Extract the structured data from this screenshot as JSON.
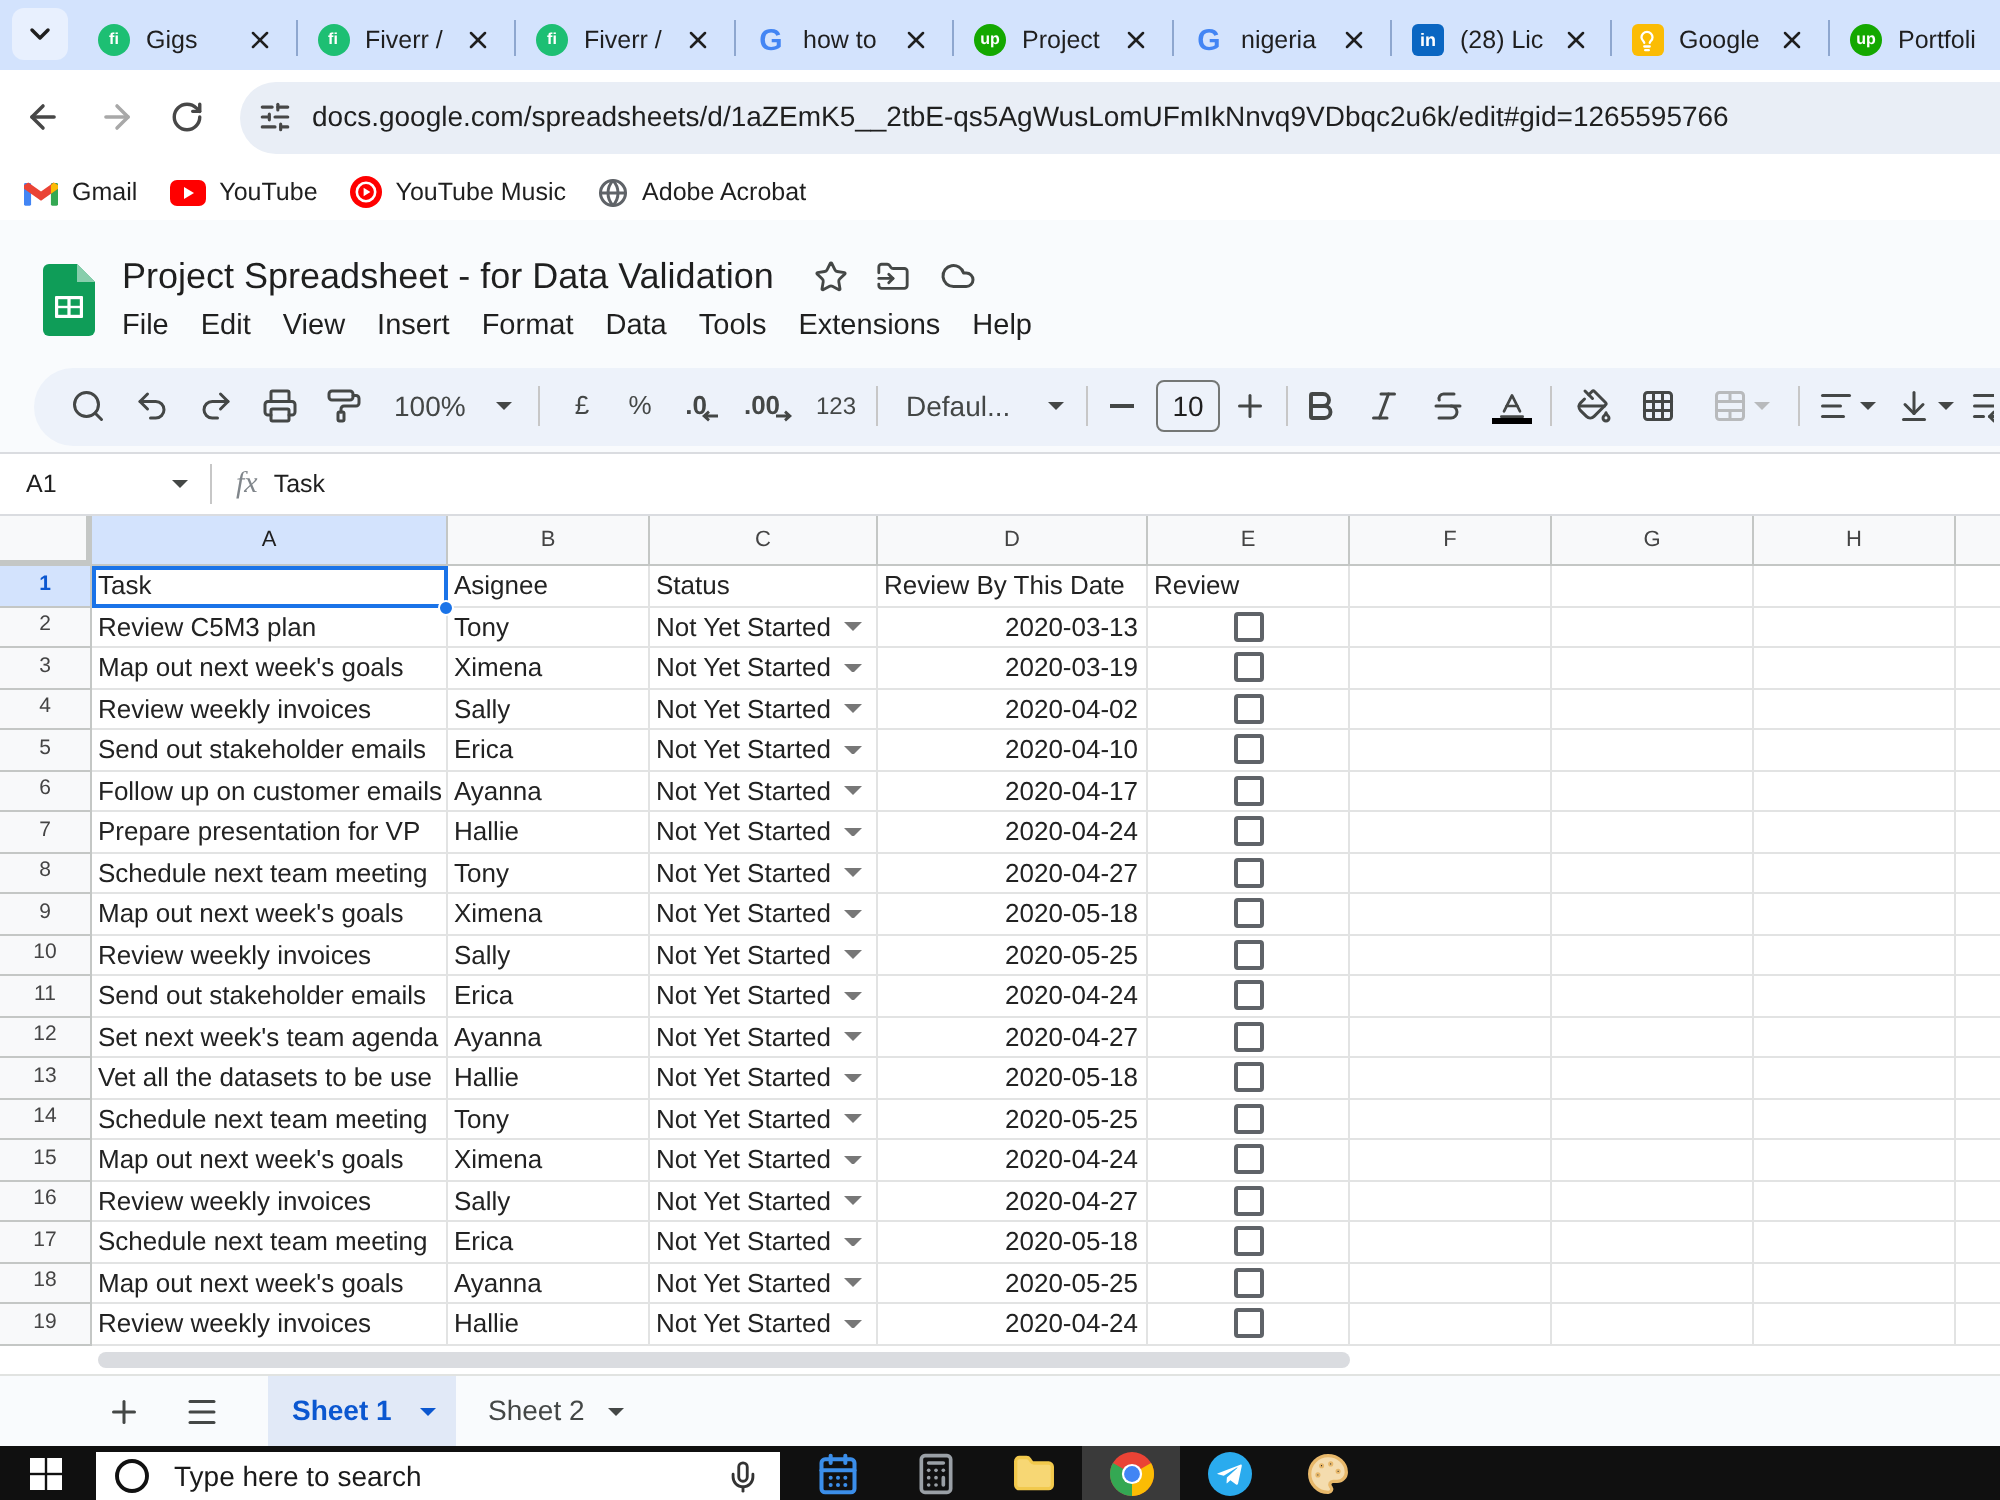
{
  "browser": {
    "tabs": [
      {
        "title": "Gigs",
        "selected": false,
        "favicon": {
          "kind": "disc",
          "color": "#1dbf73",
          "text": "fi"
        }
      },
      {
        "title": "Fiverr /",
        "selected": false,
        "favicon": {
          "kind": "disc",
          "color": "#1dbf73",
          "text": "fi"
        }
      },
      {
        "title": "Fiverr /",
        "selected": false,
        "favicon": {
          "kind": "disc",
          "color": "#1dbf73",
          "text": "fi"
        }
      },
      {
        "title": "how to",
        "selected": false,
        "favicon": {
          "kind": "letter",
          "color": "#4285f4",
          "text": "G"
        }
      },
      {
        "title": "Project",
        "selected": false,
        "favicon": {
          "kind": "disc",
          "color": "#14a800",
          "text": "up"
        }
      },
      {
        "title": "nigeria",
        "selected": false,
        "favicon": {
          "kind": "letter",
          "color": "#4285f4",
          "text": "G"
        }
      },
      {
        "title": "(28) Lic",
        "selected": false,
        "favicon": {
          "kind": "square",
          "color": "#0a66c2",
          "text": "in"
        }
      },
      {
        "title": "Google",
        "selected": false,
        "favicon": {
          "kind": "bulb",
          "color": "#fbbc04"
        }
      },
      {
        "title": "Portfoli",
        "selected": false,
        "favicon": {
          "kind": "disc",
          "color": "#14a800",
          "text": "up"
        }
      }
    ],
    "nav": {
      "forward_disabled": true
    },
    "address": {
      "url": "docs.google.com/spreadsheets/d/1aZEmK5__2tbE-qs5AgWusLomUFmIkNnvq9VDbqc2u6k/edit#gid=1265595766"
    },
    "bookmarks": [
      {
        "label": "Gmail",
        "kind": "mail"
      },
      {
        "label": "YouTube",
        "kind": "video"
      },
      {
        "label": "YouTube Music",
        "kind": "music"
      },
      {
        "label": "Adobe Acrobat",
        "kind": "globe"
      }
    ]
  },
  "sheet_doc": {
    "title": "Project Spreadsheet - for Data Validation",
    "menu": [
      "File",
      "Edit",
      "View",
      "Insert",
      "Format",
      "Data",
      "Tools",
      "Extensions",
      "Help"
    ],
    "toolbar": {
      "zoom": "100%",
      "currency": "£",
      "percent": "%",
      "decrease_decimal": ".0",
      "increase_decimal": ".00",
      "number_format": "123",
      "font": "Defaul...",
      "font_size": "10",
      "merge_disabled": true
    },
    "formula_bar": {
      "cell_ref": "A1",
      "fx": "fx",
      "content": "Task"
    },
    "columns": [
      {
        "label": "A",
        "selected": true
      },
      {
        "label": "B",
        "selected": false
      },
      {
        "label": "C",
        "selected": false
      },
      {
        "label": "D",
        "selected": false
      },
      {
        "label": "E",
        "selected": false
      },
      {
        "label": "F",
        "selected": false
      },
      {
        "label": "G",
        "selected": false
      },
      {
        "label": "H",
        "selected": false
      }
    ],
    "header_row": {
      "number": "1",
      "selected": true,
      "cells": [
        {
          "text": "Task",
          "selected": true
        },
        {
          "text": "Asignee",
          "selected": false
        },
        {
          "text": "Status",
          "selected": false
        },
        {
          "text": "Review By This Date",
          "selected": false
        },
        {
          "text": "Review",
          "selected": false
        }
      ]
    },
    "rows": [
      {
        "number": "2",
        "selected": false,
        "task": "Review C5M3 plan",
        "assignee": "Tony",
        "status": "Not Yet Started",
        "date": "2020-03-13",
        "checked": false
      },
      {
        "number": "3",
        "selected": false,
        "task": "Map out next week's goals",
        "assignee": "Ximena",
        "status": "Not Yet Started",
        "date": "2020-03-19",
        "checked": false
      },
      {
        "number": "4",
        "selected": false,
        "task": "Review weekly invoices",
        "assignee": "Sally",
        "status": "Not Yet Started",
        "date": "2020-04-02",
        "checked": false
      },
      {
        "number": "5",
        "selected": false,
        "task": "Send out stakeholder emails",
        "assignee": "Erica",
        "status": "Not Yet Started",
        "date": "2020-04-10",
        "checked": false
      },
      {
        "number": "6",
        "selected": false,
        "task": "Follow up on customer emails",
        "assignee": "Ayanna",
        "status": "Not Yet Started",
        "date": "2020-04-17",
        "checked": false
      },
      {
        "number": "7",
        "selected": false,
        "task": "Prepare presentation for VP",
        "assignee": "Hallie",
        "status": "Not Yet Started",
        "date": "2020-04-24",
        "checked": false
      },
      {
        "number": "8",
        "selected": false,
        "task": "Schedule next team meeting",
        "assignee": "Tony",
        "status": "Not Yet Started",
        "date": "2020-04-27",
        "checked": false
      },
      {
        "number": "9",
        "selected": false,
        "task": "Map out next week's goals",
        "assignee": "Ximena",
        "status": "Not Yet Started",
        "date": "2020-05-18",
        "checked": false
      },
      {
        "number": "10",
        "selected": false,
        "task": "Review weekly invoices",
        "assignee": "Sally",
        "status": "Not Yet Started",
        "date": "2020-05-25",
        "checked": false
      },
      {
        "number": "11",
        "selected": false,
        "task": "Send out stakeholder emails",
        "assignee": "Erica",
        "status": "Not Yet Started",
        "date": "2020-04-24",
        "checked": false
      },
      {
        "number": "12",
        "selected": false,
        "task": "Set next week's team agenda",
        "assignee": "Ayanna",
        "status": "Not Yet Started",
        "date": "2020-04-27",
        "checked": false
      },
      {
        "number": "13",
        "selected": false,
        "task": "Vet all the datasets to be use",
        "assignee": "Hallie",
        "status": "Not Yet Started",
        "date": "2020-05-18",
        "checked": false
      },
      {
        "number": "14",
        "selected": false,
        "task": "Schedule next team meeting",
        "assignee": "Tony",
        "status": "Not Yet Started",
        "date": "2020-05-25",
        "checked": false
      },
      {
        "number": "15",
        "selected": false,
        "task": "Map out next week's goals",
        "assignee": "Ximena",
        "status": "Not Yet Started",
        "date": "2020-04-24",
        "checked": false
      },
      {
        "number": "16",
        "selected": false,
        "task": "Review weekly invoices",
        "assignee": "Sally",
        "status": "Not Yet Started",
        "date": "2020-04-27",
        "checked": false
      },
      {
        "number": "17",
        "selected": false,
        "task": "Schedule next team meeting",
        "assignee": "Erica",
        "status": "Not Yet Started",
        "date": "2020-05-18",
        "checked": false
      },
      {
        "number": "18",
        "selected": false,
        "task": "Map out next week's goals",
        "assignee": "Ayanna",
        "status": "Not Yet Started",
        "date": "2020-05-25",
        "checked": false
      },
      {
        "number": "19",
        "selected": false,
        "task": "Review weekly invoices",
        "assignee": "Hallie",
        "status": "Not Yet Started",
        "date": "2020-04-24",
        "checked": false
      }
    ],
    "sheet_tabs": [
      {
        "label": "Sheet 1",
        "selected": true
      },
      {
        "label": "Sheet 2",
        "selected": false
      }
    ]
  },
  "taskbar": {
    "search": {
      "placeholder": "Type here to search"
    },
    "apps": [
      {
        "kind": "calendar",
        "selected": false
      },
      {
        "kind": "calculator",
        "selected": false
      },
      {
        "kind": "folder",
        "selected": false
      },
      {
        "kind": "browser",
        "selected": true
      },
      {
        "kind": "plane",
        "selected": false
      },
      {
        "kind": "palette",
        "selected": false
      }
    ]
  }
}
